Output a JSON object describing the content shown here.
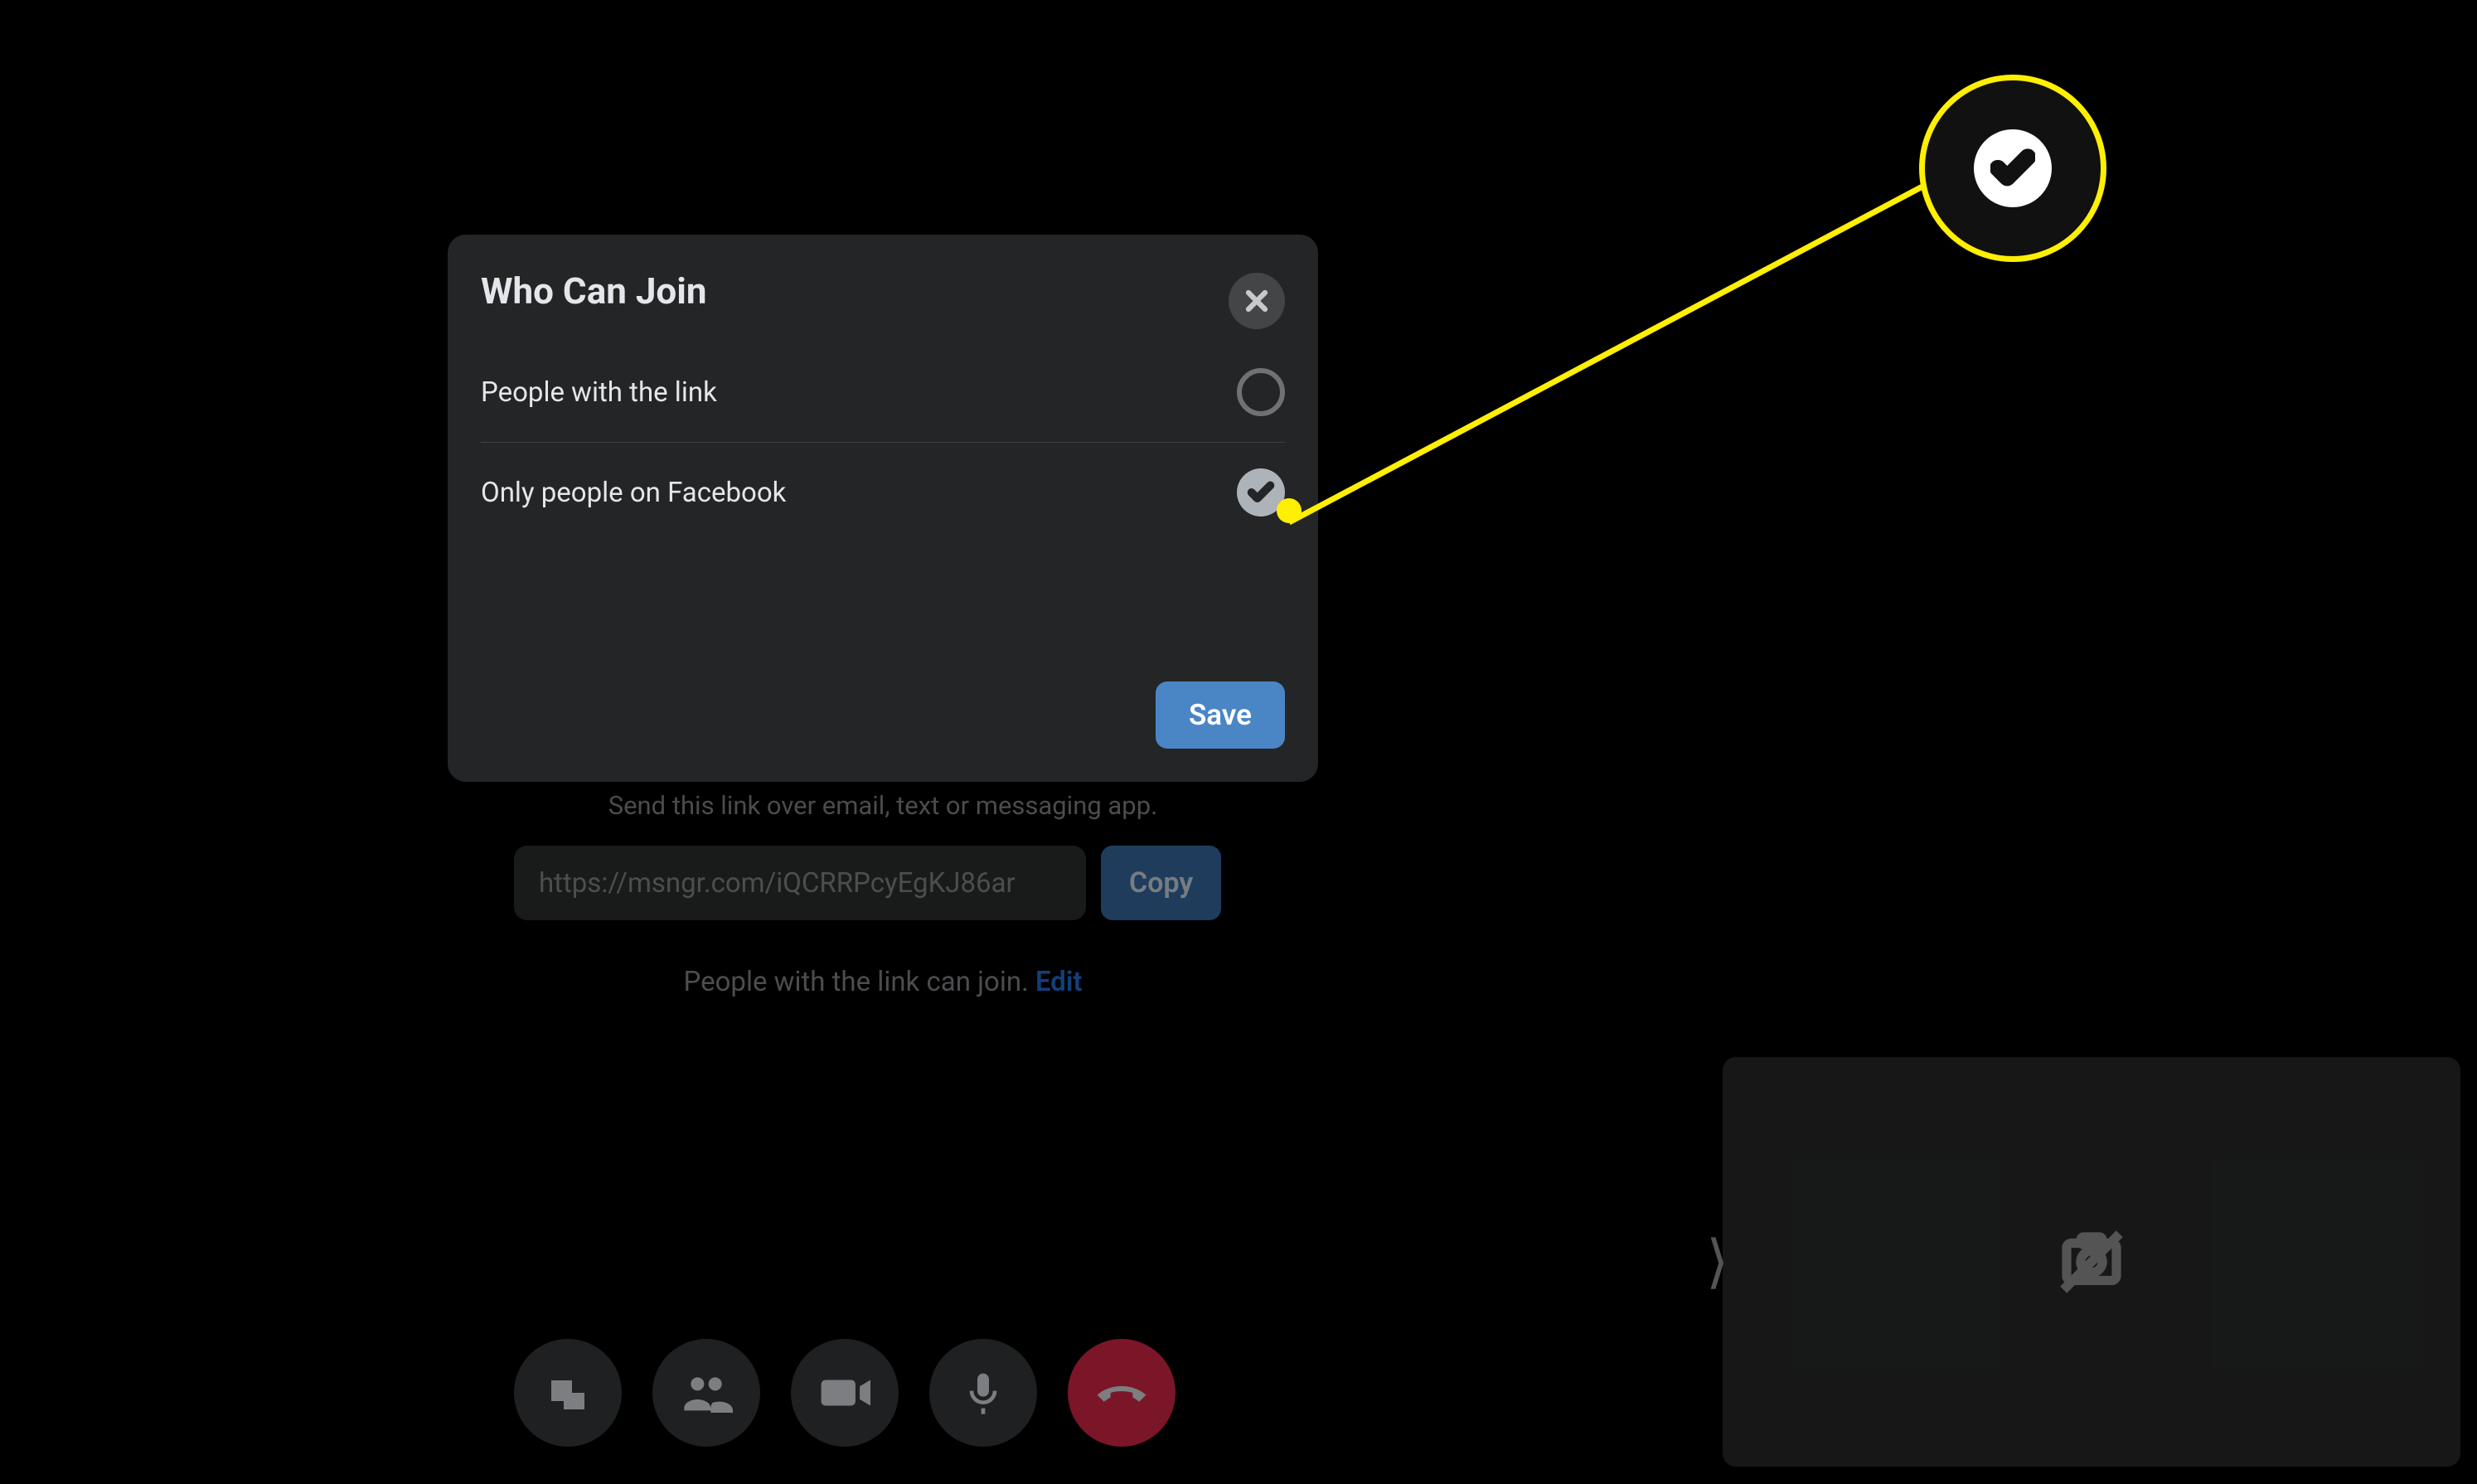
{
  "dialog": {
    "title": "Who Can Join",
    "options": [
      {
        "label": "People with the link",
        "selected": false
      },
      {
        "label": "Only people on Facebook",
        "selected": true
      }
    ],
    "save_label": "Save"
  },
  "background": {
    "invite_hint": "Send this link over email, text or messaging app.",
    "link_value": "https://msngr.com/iQCRRPcyEgKJ86ar",
    "copy_label": "Copy",
    "join_rule_text": "People with the link can join. ",
    "edit_label": "Edit"
  },
  "colors": {
    "accent_blue": "#4a86c6",
    "highlight_yellow": "#ffef00",
    "end_call_red": "#e02849"
  }
}
